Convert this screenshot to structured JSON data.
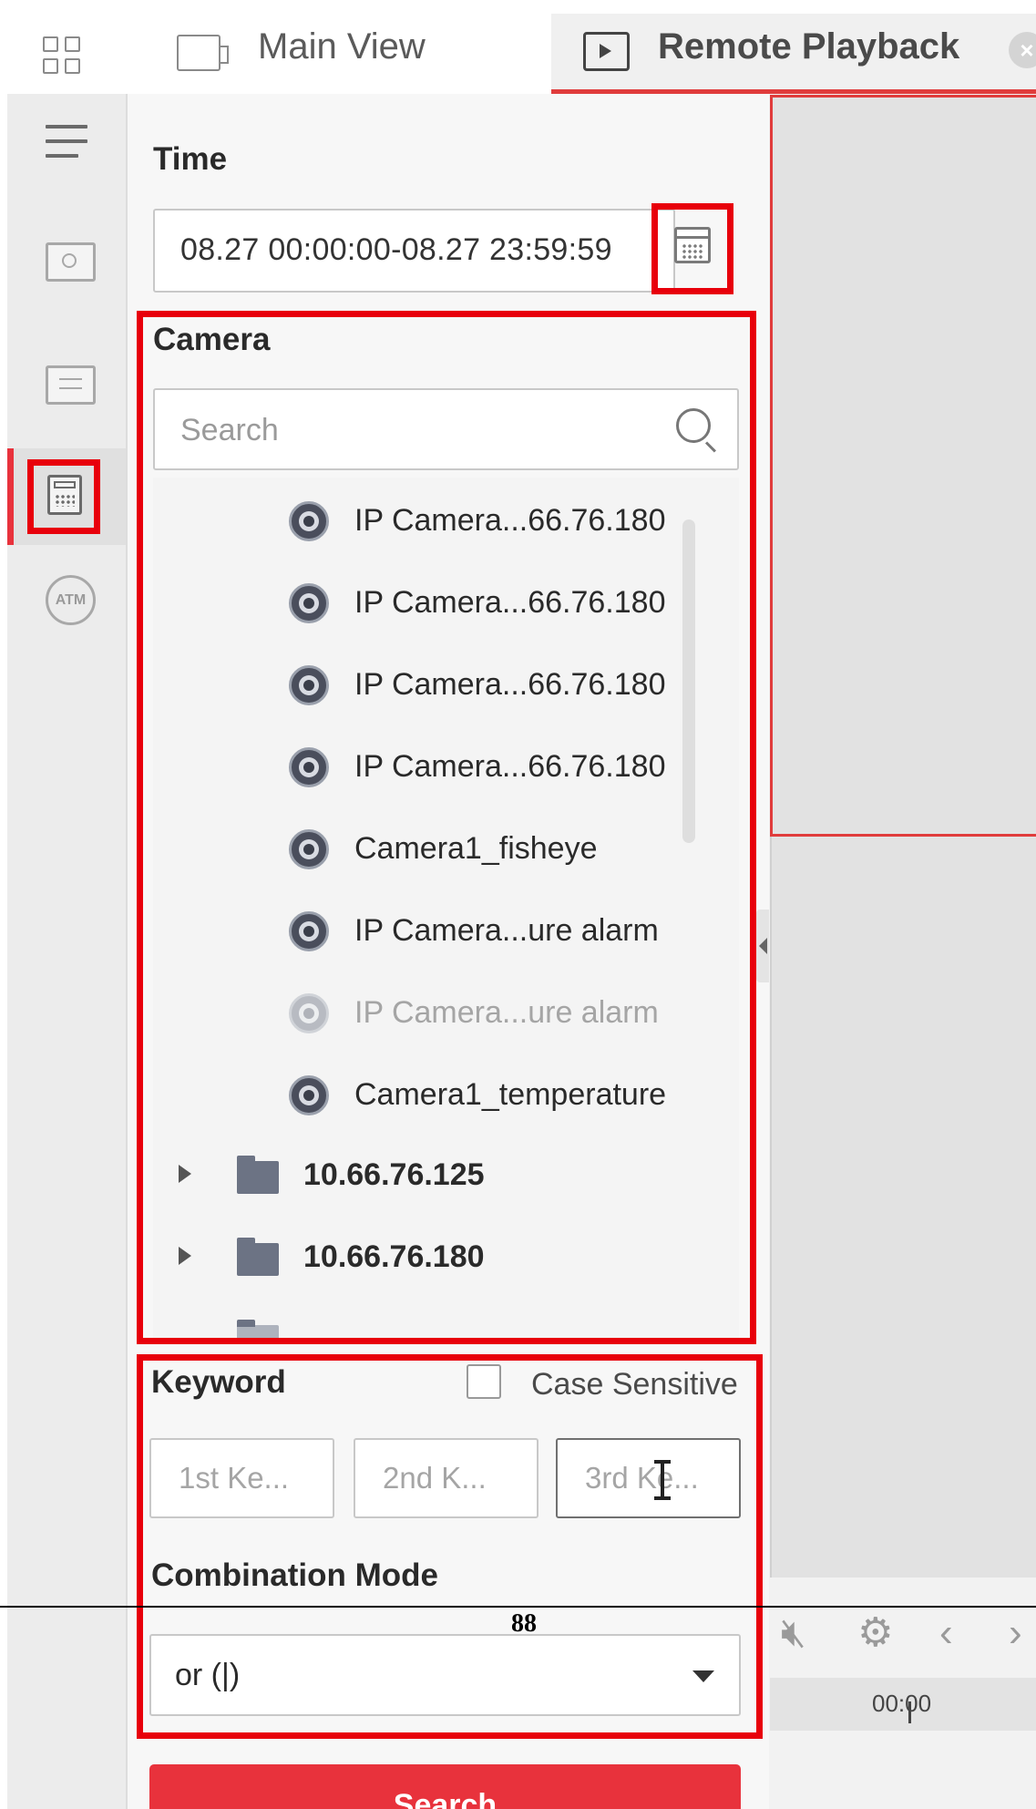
{
  "tabs": {
    "main_view": "Main View",
    "remote_playback": "Remote Playback"
  },
  "rail_icons": [
    "menu-icon",
    "playback-icon",
    "log-icon",
    "pos-icon",
    "atm-icon"
  ],
  "rail": {
    "atm_label": "ATM"
  },
  "time": {
    "label": "Time",
    "value": "08.27 00:00:00-08.27 23:59:59"
  },
  "camera": {
    "label": "Camera",
    "search_placeholder": "Search",
    "cameras": [
      {
        "name": "IP Camera...66.76.180",
        "online": true
      },
      {
        "name": "IP Camera...66.76.180",
        "online": true
      },
      {
        "name": "IP Camera...66.76.180",
        "online": true
      },
      {
        "name": "IP Camera...66.76.180",
        "online": true
      },
      {
        "name": "Camera1_fisheye",
        "online": true
      },
      {
        "name": "IP Camera...ure alarm",
        "online": true
      },
      {
        "name": "IP Camera...ure alarm",
        "online": false
      },
      {
        "name": "Camera1_temperature",
        "online": true
      }
    ],
    "folders": [
      "10.66.76.125",
      "10.66.76.180"
    ]
  },
  "keyword": {
    "label": "Keyword",
    "case_sensitive_label": "Case Sensitive",
    "case_sensitive_checked": false,
    "placeholders": [
      "1st Ke...",
      "2nd K...",
      "3rd Ke..."
    ]
  },
  "combination": {
    "label": "Combination Mode",
    "selected": "or (|)"
  },
  "search_button": "Search",
  "timeline": {
    "time": "00:00"
  },
  "page_number": "88",
  "colors": {
    "accent": "#e8323c",
    "highlight": "#e8000b"
  }
}
